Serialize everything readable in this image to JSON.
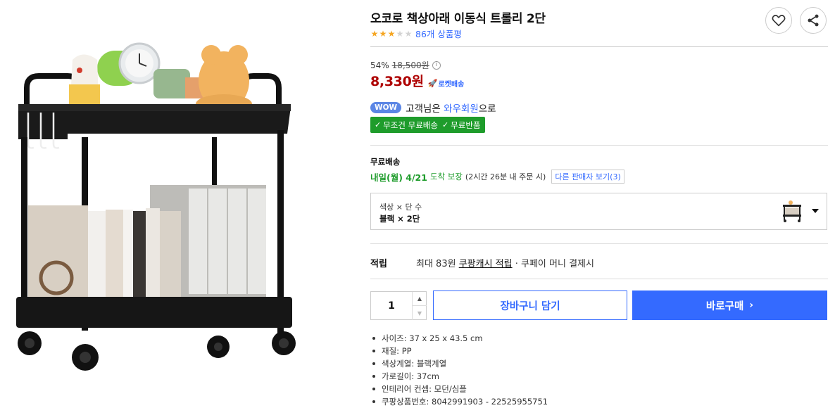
{
  "product": {
    "title": "오코로 책상아래 이동식 트롤리 2단",
    "rating": 3,
    "rating_max": 5,
    "review_count": "86개 상품평"
  },
  "price": {
    "discount": "54%",
    "original": "18,500원",
    "info_icon": "i",
    "sale": "8,330원",
    "rocket_label": "로켓배송"
  },
  "wow": {
    "badge": "WOW",
    "prefix": "고객님은",
    "member": "와우회원",
    "suffix": "으로"
  },
  "benefits": {
    "free_shipping": "무조건 무료배송",
    "free_return": "무료반품"
  },
  "shipping": {
    "label": "무료배송",
    "date": "내일(월) 4/21",
    "guarantee": "도착 보장",
    "note": "(2시간 26분 내 주문 시)",
    "other_sellers": "다른 판매자 보기(3)"
  },
  "option": {
    "name": "색상 × 단 수",
    "value": "블랙 × 2단"
  },
  "reward": {
    "label": "적립",
    "prefix": "최대 83원",
    "cash": "쿠팡캐시 적립",
    "suffix": "· 쿠페이 머니 결제시"
  },
  "purchase": {
    "quantity": "1",
    "cart_label": "장바구니 담기",
    "buy_label": "바로구매"
  },
  "specs": [
    "사이즈: 37 x 25 x 43.5 cm",
    "재질: PP",
    "색상계열: 블랙계열",
    "가로길이: 37cm",
    "인테리어 컨셉: 모던/심플",
    "쿠팡상품번호: 8042991903 - 22525955751"
  ],
  "colors": {
    "accent": "#346aff",
    "price": "#ae0000",
    "green": "#1e9c2b",
    "star": "#f5a623"
  }
}
